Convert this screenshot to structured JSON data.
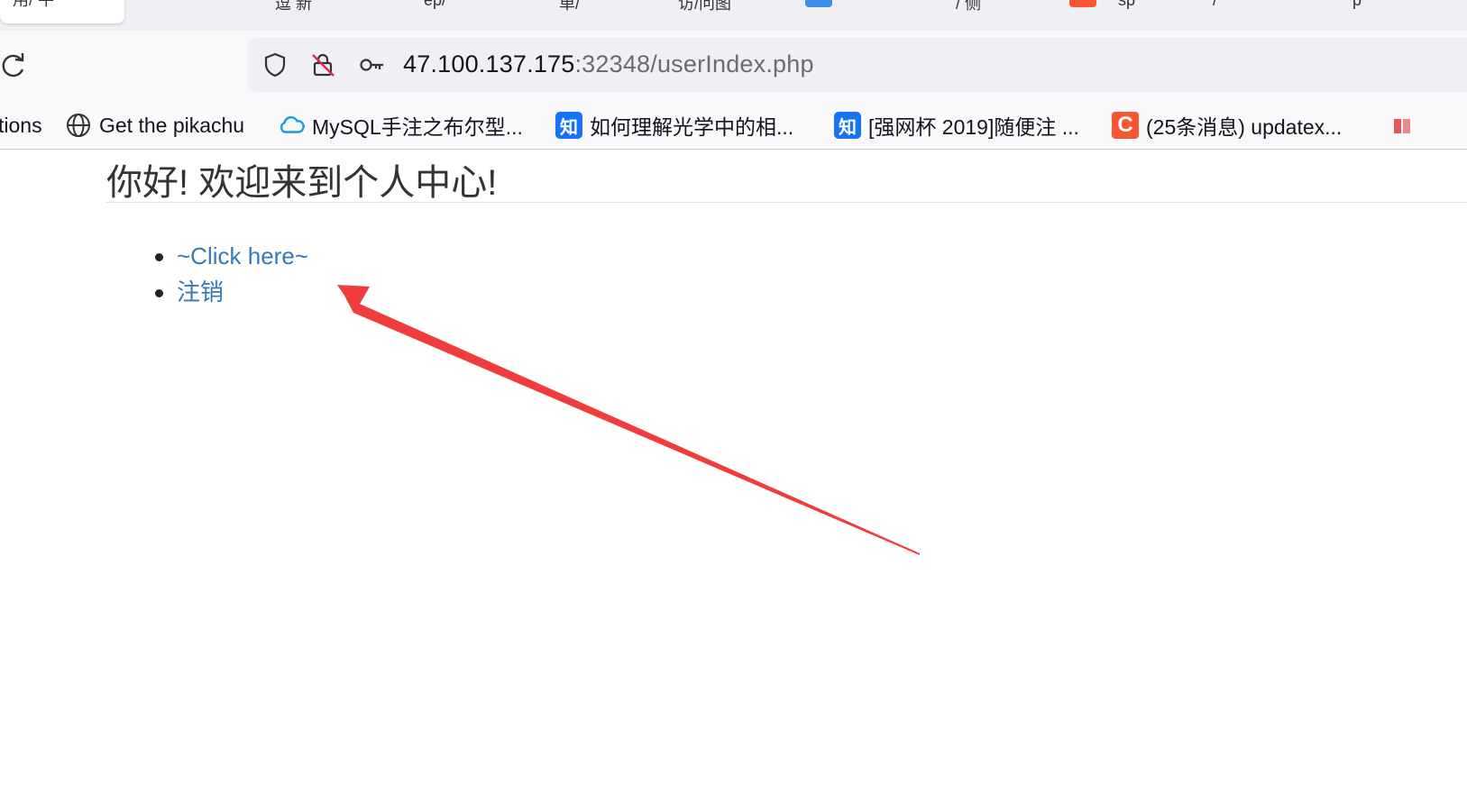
{
  "tabstrip": {
    "fragments": [
      "用/ 牛",
      "逗  新",
      "ep/",
      "单/",
      "访/问图",
      "/ 侧",
      "sp",
      "/",
      "p"
    ]
  },
  "toolbar": {
    "url_host": "47.100.137.175",
    "url_rest": ":32348/userIndex.php"
  },
  "bookmarks": {
    "items": [
      {
        "label": "tions",
        "icon": "none"
      },
      {
        "label": "Get the pikachu",
        "icon": "globe-icon"
      },
      {
        "label": "MySQL手注之布尔型...",
        "icon": "cloud-icon"
      },
      {
        "label": "如何理解光学中的相...",
        "icon": "zhihu-icon",
        "icon_text": "知"
      },
      {
        "label": "[强网杯 2019]随便注 ...",
        "icon": "zhihu-icon",
        "icon_text": "知"
      },
      {
        "label": "(25条消息) updatex...",
        "icon": "csdn-icon",
        "icon_text": "C"
      }
    ]
  },
  "page": {
    "title": "你好! 欢迎来到个人中心!",
    "links": [
      "~Click here~",
      "注销"
    ]
  },
  "colors": {
    "link": "#337ab7",
    "arrow": "#f03c3c",
    "zhihu": "#1772f6",
    "csdn": "#fc5531"
  }
}
